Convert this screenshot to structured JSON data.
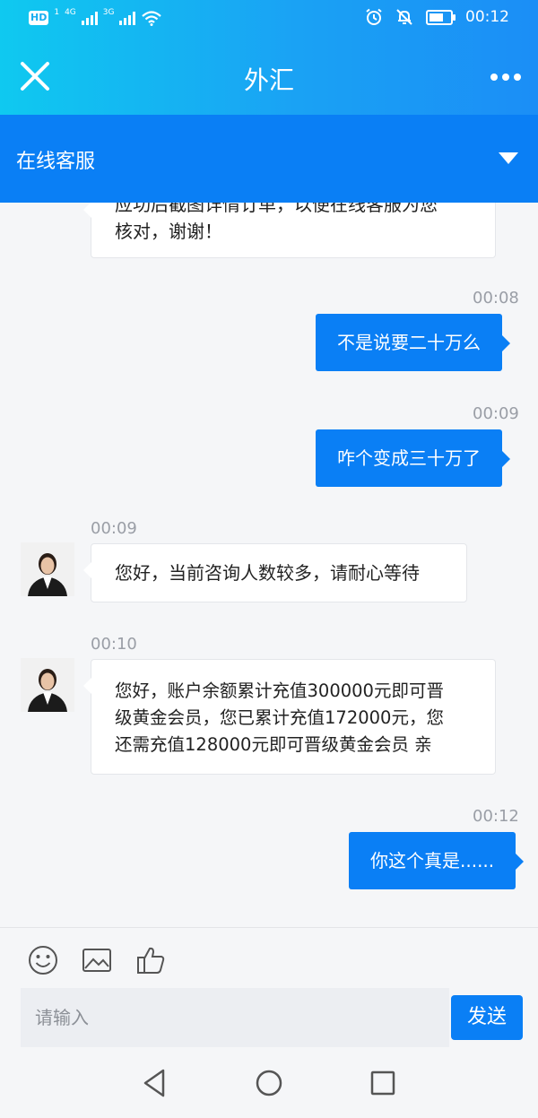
{
  "status_bar": {
    "network_badge": "HD",
    "network_sim": "1",
    "network_4g": "4G",
    "network_3g": "3G",
    "time": "00:12"
  },
  "header": {
    "title": "外汇"
  },
  "service_bar": {
    "label": "在线客服"
  },
  "messages": [
    {
      "text": "应功后截图详情订单，以便在线客服为您核对，谢谢！",
      "line1": "应功后截图详情订单，以便在线客服为您",
      "line2": "核对，谢谢！"
    },
    {
      "time": "00:08",
      "text": "不是说要二十万么"
    },
    {
      "time": "00:09",
      "text": "咋个变成三十万了"
    },
    {
      "time": "00:09",
      "text": "您好，当前咨询人数较多，请耐心等待"
    },
    {
      "time": "00:10",
      "line1": "您好，账户余额累计充值300000元即可晋",
      "line2": "级黄金会员，您已累计充值172000元，您",
      "line3": "还需充值128000元即可晋级黄金会员 亲"
    },
    {
      "time": "00:12",
      "text": "你这个真是......"
    }
  ],
  "composer": {
    "placeholder": "请输入",
    "send_label": "发送"
  },
  "colors": {
    "accent": "#0a7ff5",
    "header_start": "#0fc9f0",
    "header_end": "#1b8ef6"
  },
  "icons": {
    "toolbar": [
      "emoji-icon",
      "image-icon",
      "thumbs-up-icon"
    ],
    "nav": [
      "back-icon",
      "home-icon",
      "recents-icon"
    ]
  }
}
